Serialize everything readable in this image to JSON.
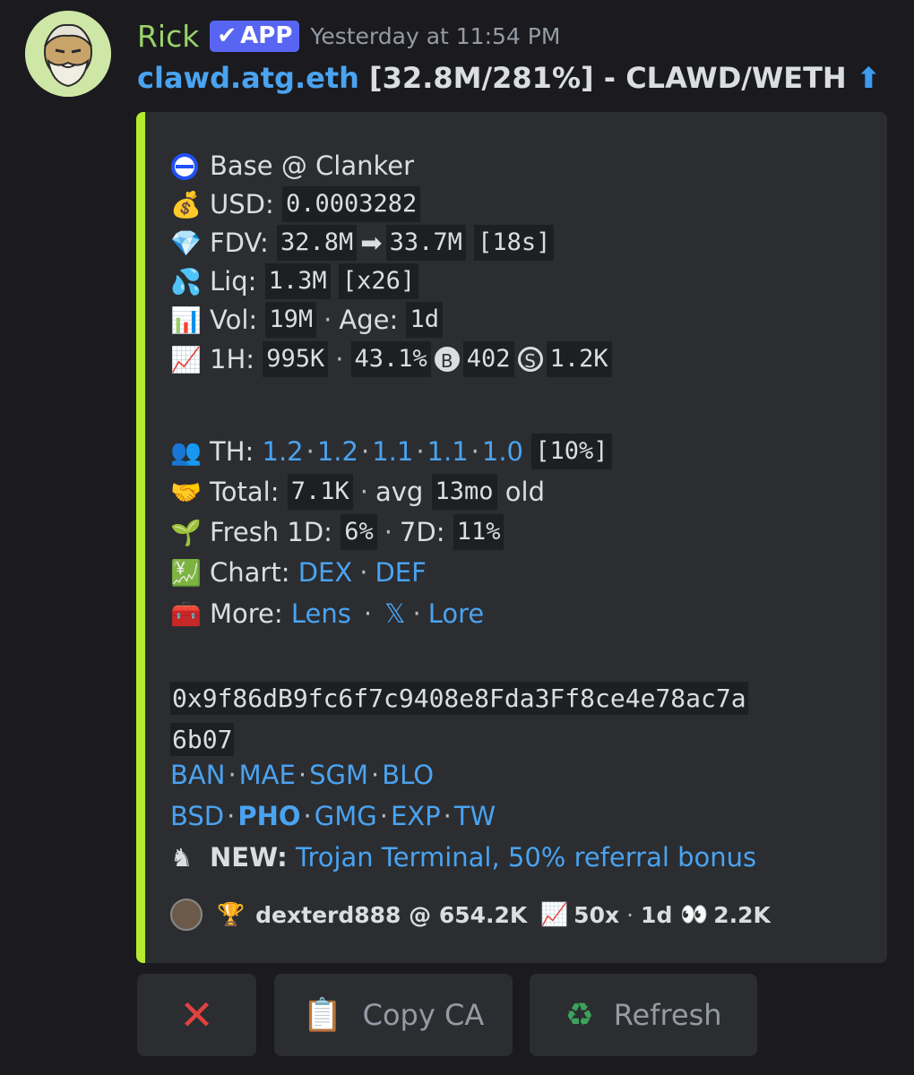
{
  "message": {
    "username": "Rick",
    "badge": "APP",
    "timestamp": "Yesterday at 11:54 PM",
    "title": {
      "link": "clawd.atg.eth",
      "text": " [32.8M/281%] - CLAWD/WETH ",
      "arrow": "⬆"
    }
  },
  "embed": {
    "accent_color": "#b5eb2f",
    "chain": "Base @ Clanker",
    "usd": {
      "label": "USD:",
      "value": "0.0003282"
    },
    "fdv": {
      "label": "FDV:",
      "from": "32.8M",
      "arrow": "➡",
      "to": "33.7M",
      "age": "[18s]"
    },
    "liq": {
      "label": "Liq:",
      "value": "1.3M",
      "mult": "[x26]"
    },
    "vol": {
      "label": "Vol:",
      "value": "19M",
      "age_label": "Age:",
      "age": "1d"
    },
    "h1": {
      "label": "1H:",
      "vol": "995K",
      "pct": "43.1%",
      "buys_icon": "B",
      "buys": "402",
      "sells_icon": "S",
      "sells": "1.2K"
    },
    "th": {
      "label": "TH:",
      "values": [
        "1.2",
        "1.2",
        "1.1",
        "1.1",
        "1.0"
      ],
      "pct": "[10%]"
    },
    "total": {
      "label": "Total:",
      "value": "7.1K",
      "avg_label": "avg",
      "avg": "13mo",
      "old": "old"
    },
    "fresh": {
      "label": "Fresh 1D:",
      "d1": "6%",
      "d7_label": "7D:",
      "d7": "11%"
    },
    "chart": {
      "label": "Chart:",
      "links": [
        "DEX",
        "DEF"
      ]
    },
    "more": {
      "label": "More:",
      "links": [
        "Lens",
        "𝕏",
        "Lore"
      ]
    },
    "address_line1": "0x9f86dB9fc6f7c9408e8Fda3Ff8ce4e78ac7a",
    "address_line2": "6b07",
    "bots1": [
      "BAN",
      "MAE",
      "SGM",
      "BLO"
    ],
    "bots2": [
      "BSD",
      "PHO",
      "GMG",
      "EXP",
      "TW"
    ],
    "new_label": "NEW:",
    "new_text": "Trojan Terminal, 50% referral bonus",
    "footer": {
      "user": "dexterd888",
      "at": "@ 654.2K",
      "mult": "50x",
      "age": "1d",
      "views": "2.2K"
    }
  },
  "buttons": {
    "close_icon": "✕",
    "copy_label": "Copy CA",
    "refresh_label": "Refresh"
  },
  "icons": [
    "bot-avatar",
    "check-icon",
    "base-chain-icon",
    "money-bag-icon",
    "diamond-icon",
    "droplets-icon",
    "bar-chart-icon",
    "chart-up-icon",
    "users-icon",
    "handshake-icon",
    "seedling-icon",
    "yen-chart-icon",
    "toolbox-icon",
    "knight-icon",
    "trophy-icon",
    "eyes-icon",
    "clipboard-icon",
    "recycle-icon"
  ]
}
